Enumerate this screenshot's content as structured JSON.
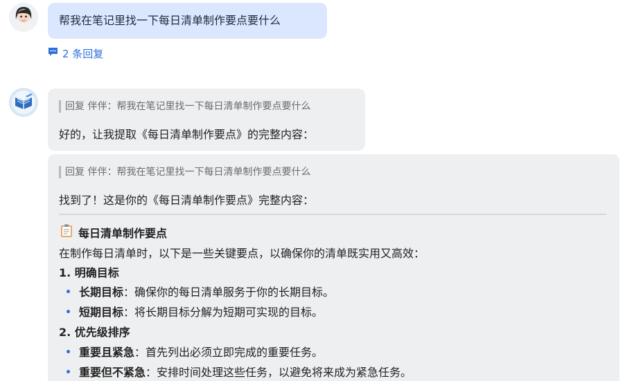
{
  "user_message": {
    "text": "帮我在笔记里找一下每日清单制作要点要什么",
    "replies_label": "2 条回复"
  },
  "bot_message_1": {
    "quote": "回复 伴伴：帮我在笔记里找一下每日清单制作要点要什么",
    "text": "好的，让我提取《每日清单制作要点》的完整内容："
  },
  "bot_message_2": {
    "quote": "回复 伴伴：帮我在笔记里找一下每日清单制作要点要什么",
    "text": "找到了！这是你的《每日清单制作要点》完整内容：",
    "note": {
      "title": "每日清单制作要点",
      "intro": "在制作每日清单时，以下是一些关键要点，以确保你的清单既实用又高效：",
      "sections": [
        {
          "heading": "1. 明确目标",
          "items": [
            {
              "term": "长期目标",
              "desc": "：确保你的每日清单服务于你的长期目标。"
            },
            {
              "term": "短期目标",
              "desc": "：将长期目标分解为短期可实现的目标。"
            }
          ]
        },
        {
          "heading": "2. 优先级排序",
          "items": [
            {
              "term": "重要且紧急",
              "desc": "：首先列出必须立即完成的重要任务。"
            },
            {
              "term": "重要但不紧急",
              "desc": "：安排时间处理这些任务，以避免将来成为紧急任务。"
            }
          ]
        }
      ]
    }
  },
  "colors": {
    "user_bubble": "#dbe7ff",
    "bot_bubble": "#eeeff1",
    "link_blue": "#2f6fd8"
  }
}
